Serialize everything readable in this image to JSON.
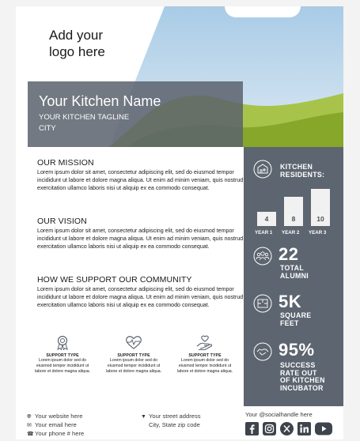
{
  "header": {
    "logo_placeholder_line1": "Add your",
    "logo_placeholder_line2": "logo here",
    "kitchen_name": "Your Kitchen Name",
    "tagline": "YOUR KITCHEN TAGLINE",
    "city": "CITY"
  },
  "sections": {
    "mission": {
      "title": "OUR MISSION",
      "body": "Lorem ipsum dolor sit amet, consectetur adipiscing elit, sed do eiusmod tempor incididunt ut labore et dolore magna aliqua. Ut enim ad minim veniam, quis nostrud exercitation ullamco laboris nisi ut aliquip ex ea commodo consequat."
    },
    "vision": {
      "title": "OUR VISION",
      "body": "Lorem ipsum dolor sit amet, consectetur adipiscing elit, sed do eiusmod tempor incididunt ut labore et dolore magna aliqua. Ut enim ad minim veniam, quis nostrud exercitation ullamco laboris nisi ut aliquip ex ea commodo consequat."
    },
    "support": {
      "title": "HOW WE SUPPORT OUR COMMUNITY",
      "body": "Lorem ipsum dolor sit amet, consectetur adipiscing elit, sed do eiusmod tempor incididunt ut labore et dolore magna aliqua. Ut enim ad minim veniam, quis nostrud exercitation ullamco laboris nisi ut aliquip ex ea commodo consequat."
    }
  },
  "support_types": [
    {
      "icon": "certificate-icon",
      "title": "SUPPORT TYPE",
      "body": "Lorem ipsum dolor sed do eiusmod tempor incididunt ut labore et dolore magna aliqua."
    },
    {
      "icon": "heartbeat-icon",
      "title": "SUPPORT TYPE",
      "body": "Lorem ipsum dolor sed do eiusmod tempor incididunt ut labore et dolore magna aliqua."
    },
    {
      "icon": "helping-hand-icon",
      "title": "SUPPORT TYPE",
      "body": "Lorem ipsum dolor sed do eiusmod tempor incididunt ut labore et dolore magna aliqua."
    }
  ],
  "stats": {
    "residents": {
      "title_line1": "KITCHEN",
      "title_line2": "RESIDENTS:",
      "bars": [
        {
          "label": "YEAR 1",
          "value": "4"
        },
        {
          "label": "YEAR 2",
          "value": "8"
        },
        {
          "label": "YEAR 3",
          "value": "10"
        }
      ]
    },
    "alumni": {
      "value": "22",
      "label_line1": "TOTAL",
      "label_line2": "ALUMNI"
    },
    "space": {
      "value": "5K",
      "label_line1": "SQUARE",
      "label_line2": "FEET"
    },
    "success": {
      "value": "95%",
      "label_line1": "SUCCESS",
      "label_line2": "RATE OUT",
      "label_line3": "OF KITCHEN",
      "label_line4": "INCUBATOR"
    }
  },
  "footer": {
    "website": "Your website here",
    "email": "Your email here",
    "phone": "Your phone # here",
    "street": "Your street address",
    "city_state": "City, State zip code",
    "social_handle": "Your @socialhandle here"
  },
  "colors": {
    "sidebar": "#5d6570",
    "sky": "#b9d5ea",
    "grass": "#8fae2b",
    "overlay": "#5a626c"
  }
}
